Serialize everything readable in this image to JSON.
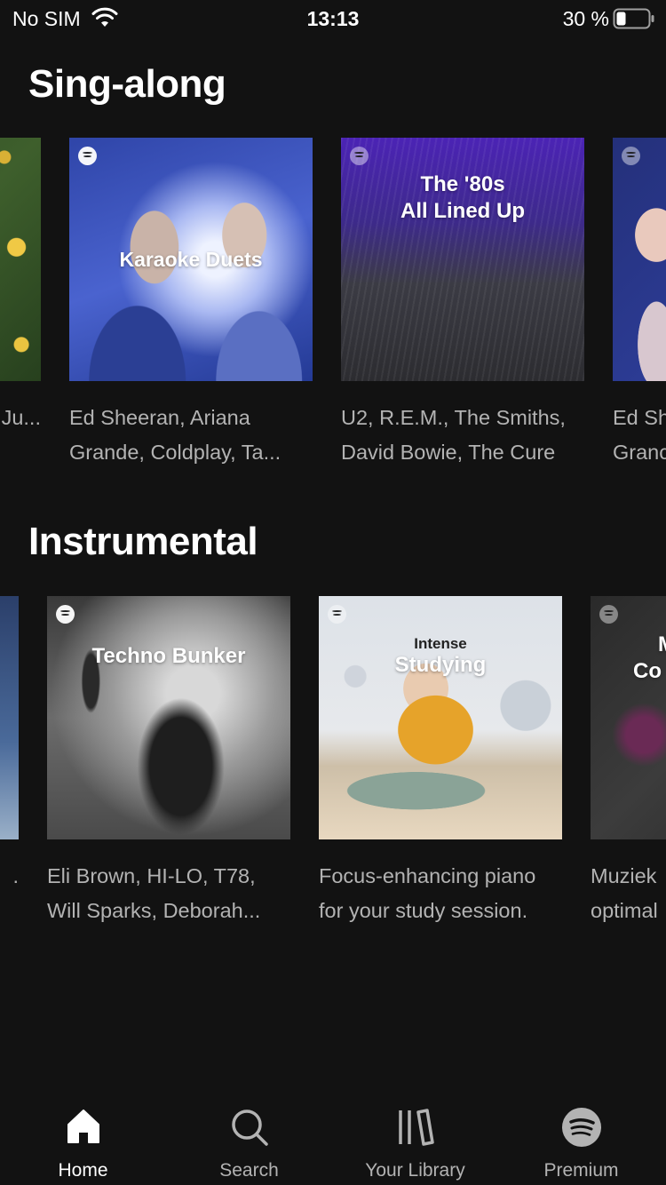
{
  "status_bar": {
    "carrier": "No SIM",
    "time": "13:13",
    "battery": "30 %"
  },
  "sections": [
    {
      "title": "Sing-along",
      "cards": [
        {
          "cover_title": "",
          "desc_line1": "",
          "desc_line2": "Ju..."
        },
        {
          "cover_title": "Karaoke Duets",
          "desc_line1": "Ed Sheeran, Ariana",
          "desc_line2": "Grande, Coldplay, Ta..."
        },
        {
          "cover_title_line1": "The '80s",
          "cover_title_line2": "All Lined Up",
          "desc_line1": "U2, R.E.M., The Smiths,",
          "desc_line2": "David Bowie, The Cure"
        },
        {
          "cover_title": "",
          "desc_line1": "Ed Sh",
          "desc_line2": "Granc"
        }
      ]
    },
    {
      "title": "Instrumental",
      "cards": [
        {
          "cover_title": "",
          "desc_line1": "",
          "desc_line2": "."
        },
        {
          "cover_title": "Techno Bunker",
          "desc_line1": "Eli Brown, HI-LO, T78,",
          "desc_line2": "Will Sparks, Deborah..."
        },
        {
          "cover_title_small": "Intense",
          "cover_title": "Studying",
          "desc_line1": "Focus-enhancing piano",
          "desc_line2": "for your study session."
        },
        {
          "cover_title_line1": "M",
          "cover_title_line2": "Co",
          "desc_line1": "Muziek",
          "desc_line2": "optimal"
        }
      ]
    }
  ],
  "tabs": [
    {
      "label": "Home",
      "icon": "home-icon",
      "active": true
    },
    {
      "label": "Search",
      "icon": "search-icon",
      "active": false
    },
    {
      "label": "Your Library",
      "icon": "library-icon",
      "active": false
    },
    {
      "label": "Premium",
      "icon": "spotify-icon",
      "active": false
    }
  ],
  "colors": {
    "background": "#121212",
    "text_primary": "#ffffff",
    "text_secondary": "#b3b3b3"
  }
}
